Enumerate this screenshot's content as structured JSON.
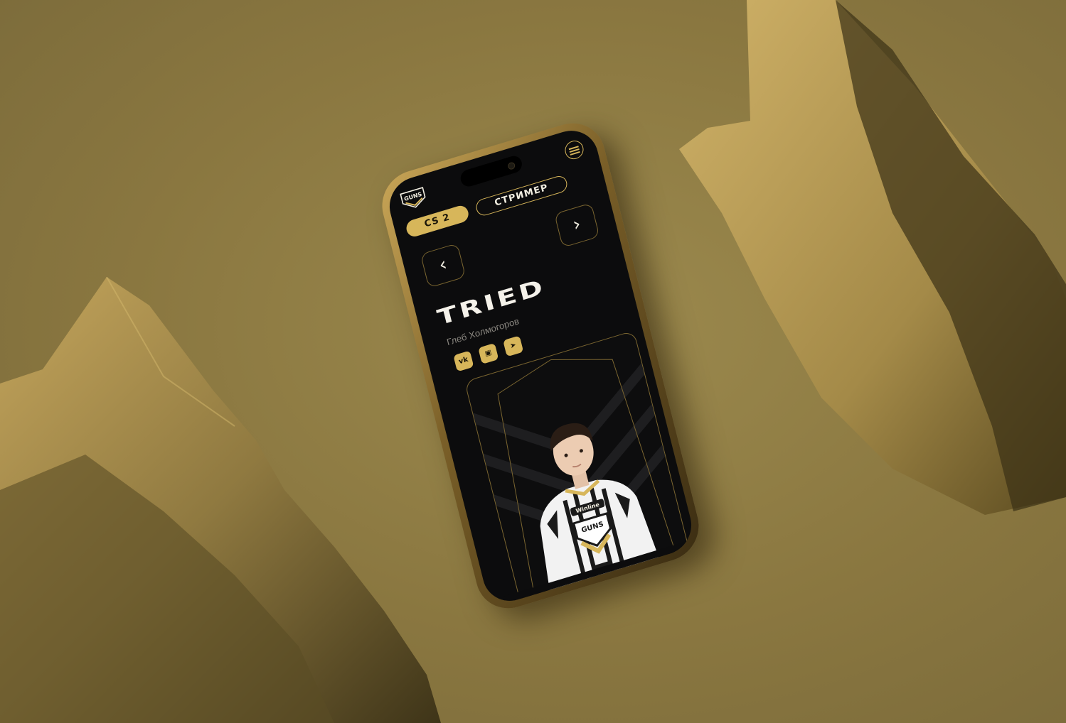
{
  "colors": {
    "background": "#8a7740",
    "accent_gold": "#d7b65a",
    "screen_bg": "#0c0c0d",
    "text_primary": "#f5f2ea",
    "text_muted": "#8a8780"
  },
  "header": {
    "logo_icon": "guns-team-logo",
    "menu_icon": "hamburger-menu-icon"
  },
  "tabs": [
    {
      "label": "CS 2",
      "active": true
    },
    {
      "label": "СТРИМЕР",
      "active": false
    }
  ],
  "navigation": {
    "prev_icon": "chevron-left-icon",
    "next_icon": "chevron-right-icon",
    "prev_glyph": "‹",
    "next_glyph": "›"
  },
  "player": {
    "nickname": "TRIED",
    "real_name": "Глеб Холмогоров"
  },
  "socials": [
    {
      "icon": "vk-icon",
      "glyph": "vk"
    },
    {
      "icon": "twitch-icon",
      "glyph": "▣"
    },
    {
      "icon": "telegram-icon",
      "glyph": "➤"
    }
  ],
  "jersey": {
    "sponsor": "Winline",
    "team_mark": "GUNS"
  }
}
